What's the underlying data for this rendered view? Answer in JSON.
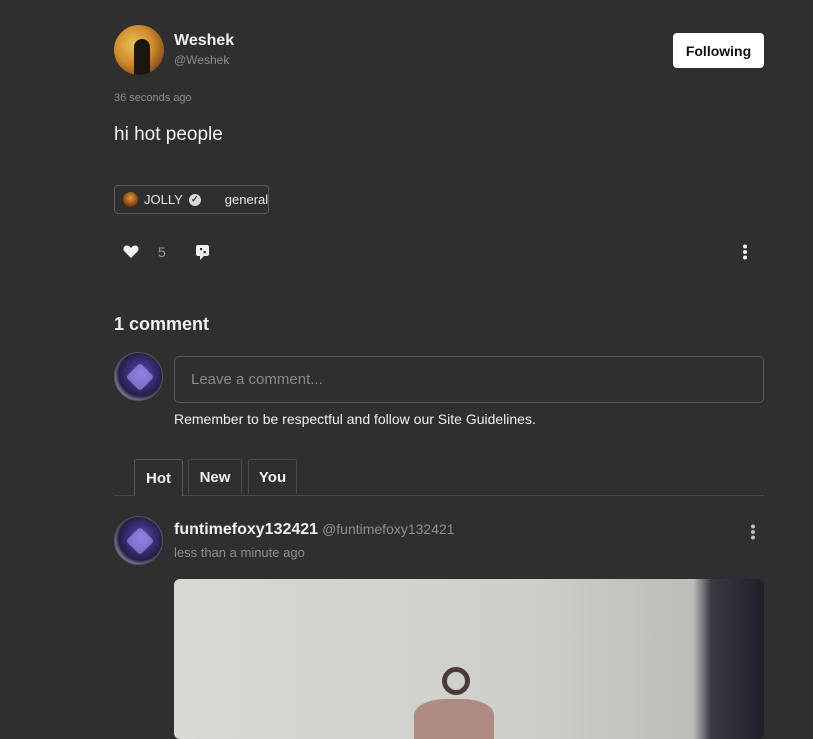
{
  "post": {
    "author_name": "Weshek",
    "author_handle": "@Weshek",
    "follow_label": "Following",
    "timestamp": "36 seconds ago",
    "text": "hi hot people",
    "community_tag": "JOLLY",
    "channel_tag": "general",
    "like_count": "5"
  },
  "comments": {
    "count_label": "1 comment",
    "input_placeholder": "Leave a comment...",
    "guidelines_text": "Remember to be respectful and follow our Site Guidelines.",
    "tabs": [
      {
        "label": "Hot",
        "active": true
      },
      {
        "label": "New",
        "active": false
      },
      {
        "label": "You",
        "active": false
      }
    ],
    "items": [
      {
        "author_name": "funtimefoxy132421",
        "author_handle": "@funtimefoxy132421",
        "time": "less than a minute ago"
      }
    ]
  },
  "icons": {
    "like": "heart-icon",
    "share": "share-icon",
    "more": "more-vertical-icon",
    "verified": "verified-badge-icon"
  },
  "colors": {
    "background": "#2f2f2f",
    "follow_button_bg": "#ffffff",
    "muted_text": "#8f8f8f"
  }
}
